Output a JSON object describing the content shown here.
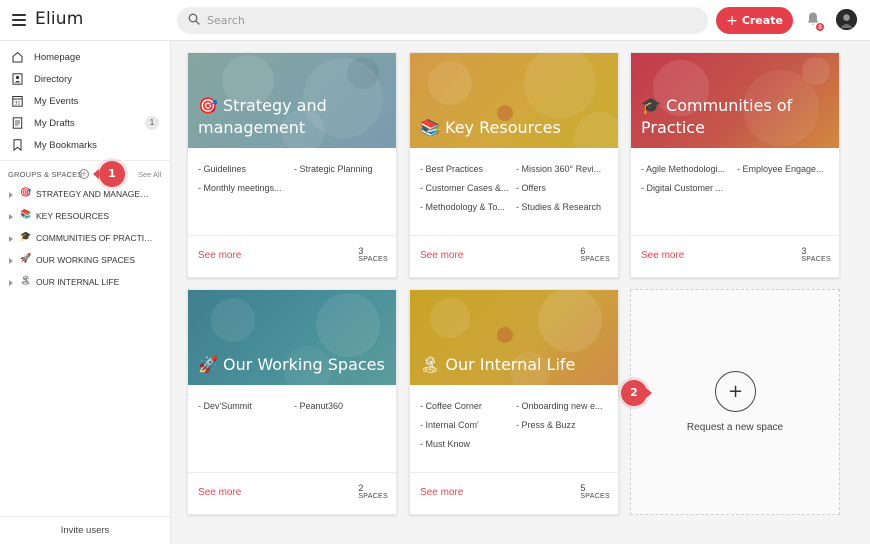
{
  "app": {
    "name": "Elium"
  },
  "header": {
    "search_placeholder": "Search",
    "create_label": "Create",
    "notifications_count": "8"
  },
  "sidebar": {
    "nav": [
      {
        "label": "Homepage",
        "icon": "home-icon"
      },
      {
        "label": "Directory",
        "icon": "directory-icon"
      },
      {
        "label": "My Events",
        "icon": "calendar-icon"
      },
      {
        "label": "My Drafts",
        "icon": "drafts-icon",
        "count": "1"
      },
      {
        "label": "My Bookmarks",
        "icon": "bookmark-icon"
      }
    ],
    "groups_label": "GROUPS & SPACES",
    "see_all": "See All",
    "spaces": [
      {
        "emoji": "🎯",
        "label": "STRATEGY AND MANAGEME..."
      },
      {
        "emoji": "📚",
        "label": "KEY RESOURCES"
      },
      {
        "emoji": "🎓",
        "label": "COMMUNITIES OF PRACTICE"
      },
      {
        "emoji": "🚀",
        "label": "OUR WORKING SPACES"
      },
      {
        "emoji": "🏝",
        "label": "OUR INTERNAL LIFE"
      }
    ],
    "invite": "Invite users"
  },
  "steps": [
    "1",
    "2"
  ],
  "cards": [
    {
      "emoji": "🎯",
      "title": "Strategy and management",
      "color": "#7fa8aa",
      "links": [
        "- Guidelines",
        "- Strategic Planning",
        "- Monthly meetings..."
      ],
      "see_more": "See more",
      "count": "3",
      "unit": "SPACES"
    },
    {
      "emoji": "📚",
      "title": "Key Resources",
      "color": "#d4a43a",
      "links": [
        "- Best Practices",
        "- Mission 360° Revi...",
        "- Customer Cases &...",
        "- Offers",
        "- Methodology & To...",
        "- Studies & Research"
      ],
      "see_more": "See more",
      "count": "6",
      "unit": "SPACES"
    },
    {
      "emoji": "🎓",
      "title": "Communities of Practice",
      "color": "#c9404f",
      "links": [
        "- Agile Methodologi...",
        "- Employee Engage...",
        "- Digital Customer ..."
      ],
      "see_more": "See more",
      "count": "3",
      "unit": "SPACES"
    },
    {
      "emoji": "🚀",
      "title": "Our Working Spaces",
      "color": "#4a8f98",
      "links": [
        "- Dev'Summit",
        "- Peanut360"
      ],
      "see_more": "See more",
      "count": "2",
      "unit": "SPACES"
    },
    {
      "emoji": "🏝",
      "title": "Our Internal Life",
      "color": "#c9a33a",
      "links": [
        "- Coffee Corner",
        "- Onboarding new e...",
        "- Internal Com'",
        "- Press & Buzz",
        "- Must Know"
      ],
      "see_more": "See more",
      "count": "5",
      "unit": "SPACES"
    }
  ],
  "request": {
    "label": "Request a new space"
  }
}
